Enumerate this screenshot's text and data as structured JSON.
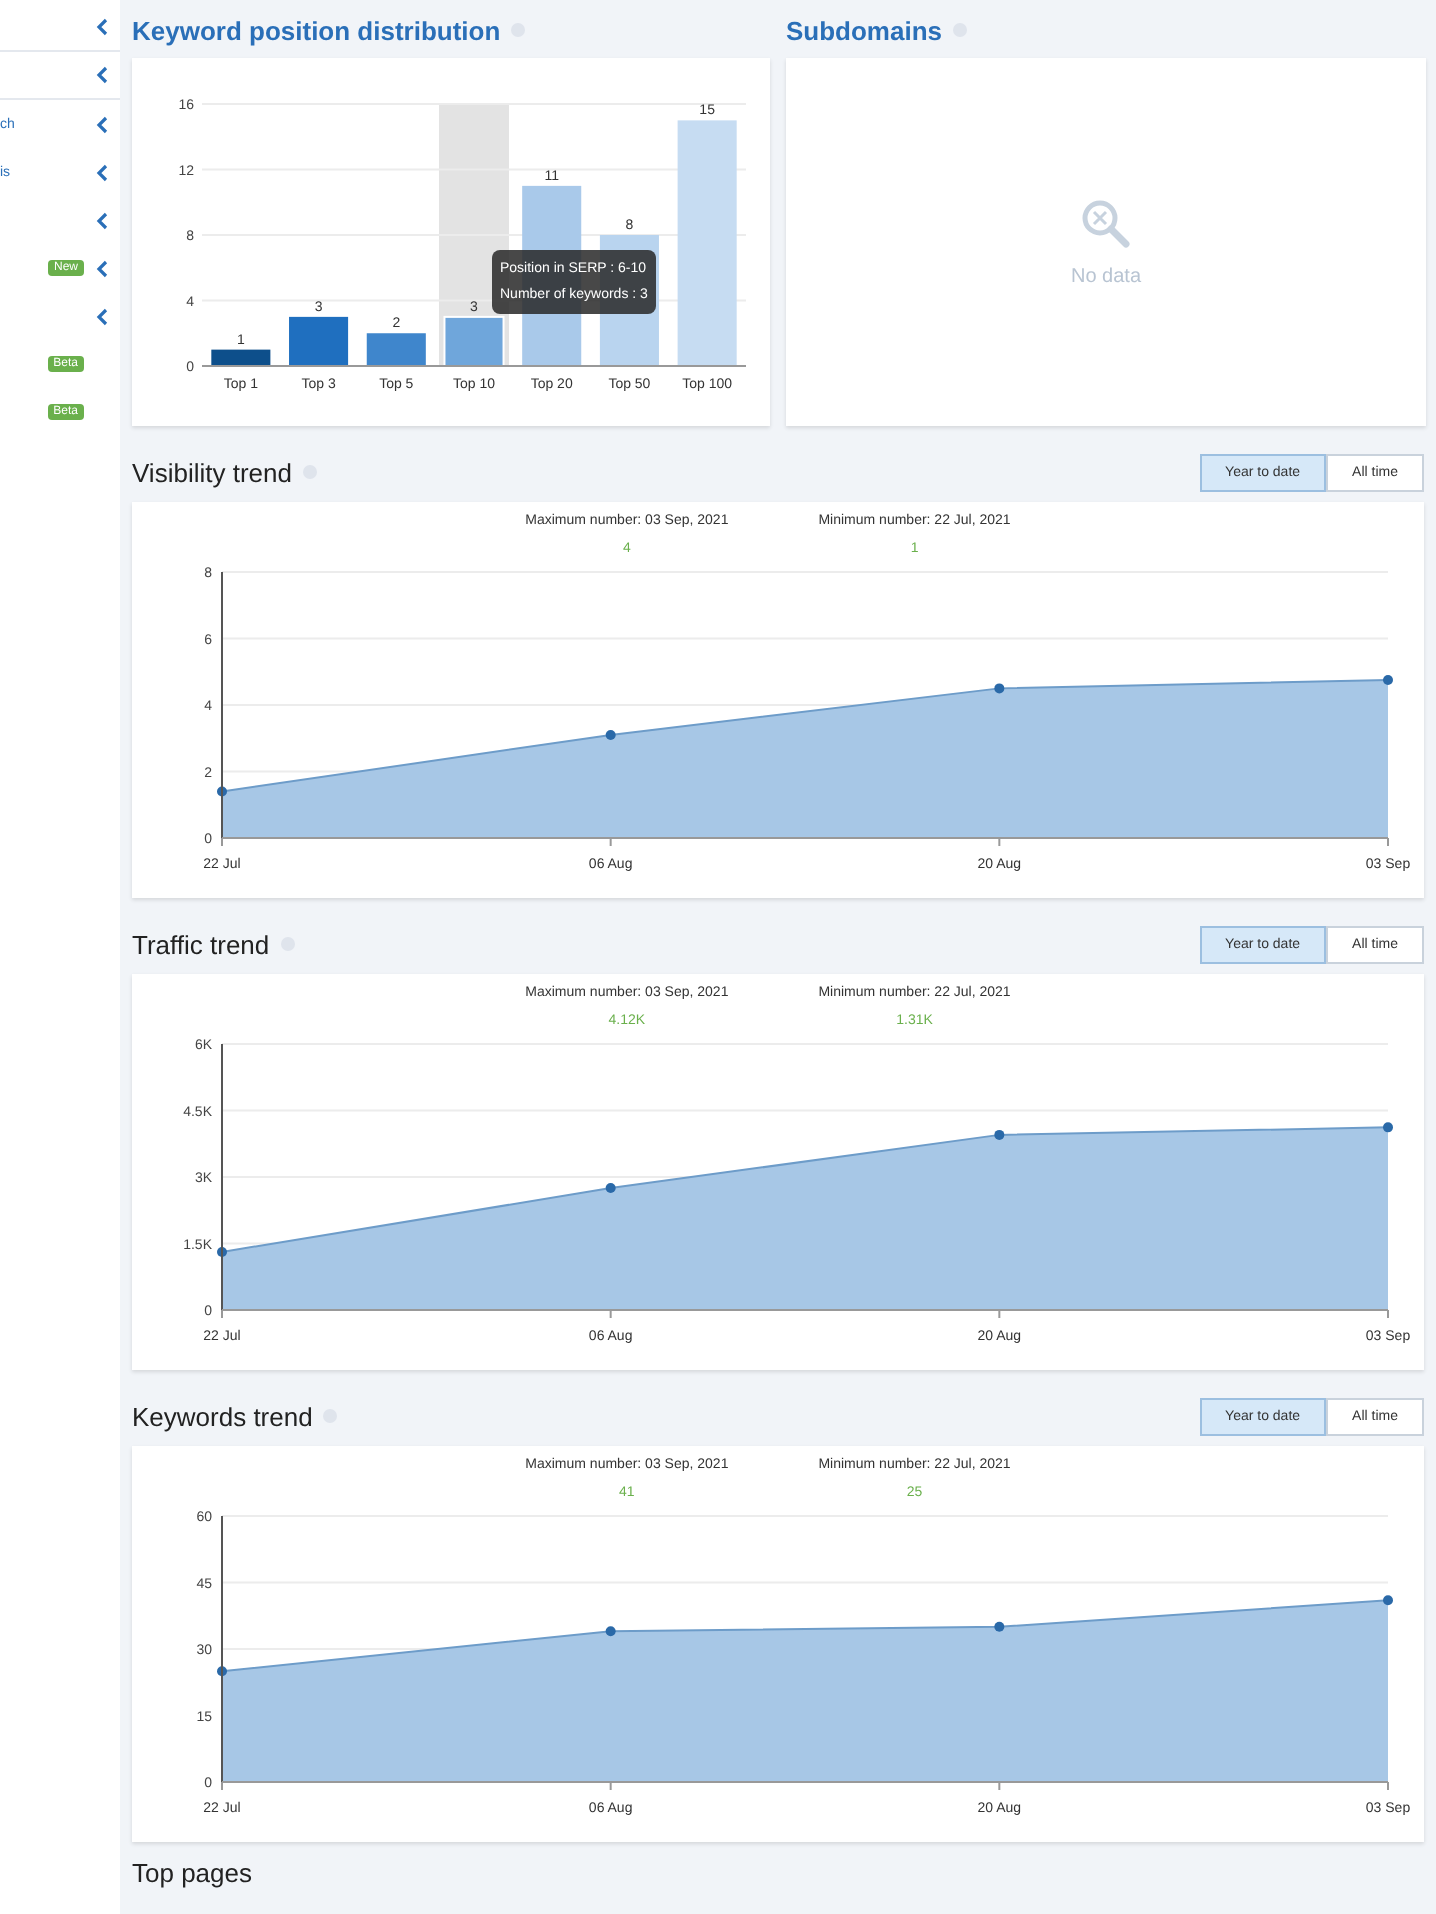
{
  "sidebar": {
    "items": [
      {
        "divider": true,
        "chevron": true
      },
      {
        "divider": true,
        "chevron": true
      },
      {
        "label": "ch",
        "divider": false,
        "chevron": true
      },
      {
        "label": "is",
        "divider": false,
        "chevron": true
      },
      {
        "divider": false,
        "chevron": true
      },
      {
        "badge": "New",
        "divider": false,
        "chevron": true
      },
      {
        "divider": false,
        "chevron": true
      },
      {
        "badge": "Beta",
        "divider": false,
        "chevron": false
      },
      {
        "badge": "Beta",
        "divider": false,
        "chevron": false
      }
    ]
  },
  "keyword_distribution": {
    "title": "Keyword position distribution",
    "hovered": [
      false,
      false,
      false,
      true,
      false,
      false,
      false
    ],
    "tooltip": [
      "Position in SERP : 6-10",
      "Number of keywords : 3"
    ],
    "chart_data": {
      "type": "bar",
      "categories": [
        "Top 1",
        "Top 3",
        "Top 5",
        "Top 10",
        "Top 20",
        "Top 50",
        "Top 100"
      ],
      "values": [
        1,
        3,
        2,
        3,
        11,
        8,
        15
      ],
      "ylim": [
        0,
        16
      ],
      "yticks": [
        0,
        4,
        8,
        12,
        16
      ],
      "data_labels": true,
      "grid": true
    }
  },
  "subdomains": {
    "title": "Subdomains",
    "empty_text": "No data"
  },
  "trends": [
    {
      "title": "Visibility trend",
      "range_buttons": [
        {
          "label": "Year to date",
          "selected": true
        },
        {
          "label": "All time",
          "selected": false
        }
      ],
      "max_label": "Maximum number: 03 Sep, 2021",
      "max_value": "4",
      "min_label": "Minimum number: 22 Jul, 2021",
      "min_value": "1",
      "chart_data": {
        "type": "area",
        "categories": [
          "22 Jul",
          "06 Aug",
          "20 Aug",
          "03 Sep"
        ],
        "values": [
          1.4,
          3.1,
          4.5,
          4.75
        ],
        "ylim": [
          0,
          8
        ],
        "yticks": [
          0,
          2,
          4,
          6,
          8
        ],
        "grid": true
      }
    },
    {
      "title": "Traffic trend",
      "range_buttons": [
        {
          "label": "Year to date",
          "selected": true
        },
        {
          "label": "All time",
          "selected": false
        }
      ],
      "max_label": "Maximum number: 03 Sep, 2021",
      "max_value": "4.12K",
      "min_label": "Minimum number: 22 Jul, 2021",
      "min_value": "1.31K",
      "chart_data": {
        "type": "area",
        "categories": [
          "22 Jul",
          "06 Aug",
          "20 Aug",
          "03 Sep"
        ],
        "values": [
          1310,
          2750,
          3950,
          4120
        ],
        "ylim": [
          0,
          6000
        ],
        "yticks": [
          {
            "value": 0,
            "label": "0"
          },
          {
            "value": 1500,
            "label": "1.5K"
          },
          {
            "value": 3000,
            "label": "3K"
          },
          {
            "value": 4500,
            "label": "4.5K"
          },
          {
            "value": 6000,
            "label": "6K"
          }
        ],
        "grid": true
      }
    },
    {
      "title": "Keywords trend",
      "range_buttons": [
        {
          "label": "Year to date",
          "selected": true
        },
        {
          "label": "All time",
          "selected": false
        }
      ],
      "max_label": "Maximum number: 03 Sep, 2021",
      "max_value": "41",
      "min_label": "Minimum number: 22 Jul, 2021",
      "min_value": "25",
      "chart_data": {
        "type": "area",
        "categories": [
          "22 Jul",
          "06 Aug",
          "20 Aug",
          "03 Sep"
        ],
        "values": [
          25,
          34,
          35,
          41
        ],
        "ylim": [
          0,
          60
        ],
        "yticks": [
          0,
          15,
          30,
          45,
          60
        ],
        "grid": true
      }
    }
  ],
  "next_section": {
    "title": "Top pages"
  }
}
